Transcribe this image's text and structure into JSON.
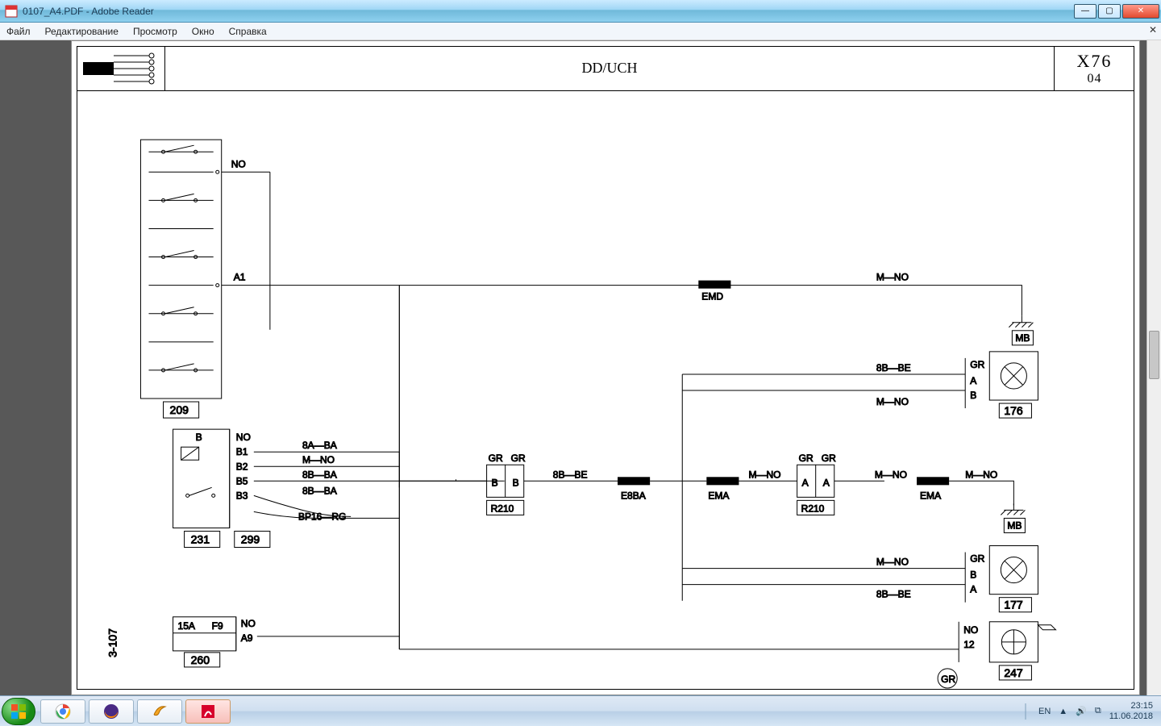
{
  "window": {
    "title": "0107_A4.PDF - Adobe Reader"
  },
  "menus": {
    "file": "Файл",
    "edit": "Редактирование",
    "view": "Просмотр",
    "window": "Окно",
    "help": "Справка"
  },
  "titleblock": {
    "mid": "DD/UCH",
    "right_top": "X76",
    "right_bottom": "04"
  },
  "diagram": {
    "page_side_label": "3-107",
    "node_labels": {
      "c209": "209",
      "c231": "231",
      "c299": "299",
      "c260": "260",
      "c176": "176",
      "c177": "177",
      "c247": "247",
      "r210_a": "R210",
      "r210_b": "R210"
    },
    "wire_texts": {
      "NO1": "NO",
      "A1": "A1",
      "B": "B",
      "NO2": "NO",
      "B1": "B1",
      "B2": "B2",
      "B5": "B5",
      "B3": "B3",
      "w_8A_BA": "8A—BA",
      "w_M_NO": "M—NO",
      "w_8B_BA": "8B—BA",
      "w_8B_BA2": "8B—BA",
      "w_BP16_RG": "BP16—RG",
      "gr_l": "GR",
      "b_l": "B",
      "gr_r": "GR",
      "b_r": "B",
      "w_8B_BE": "8B—BE",
      "E8BA": "E8BA",
      "EMA_l": "EMA",
      "EMA_r": "EMA",
      "EMD": "EMD",
      "gr_a": "GR",
      "a_l": "A",
      "gr_b": "GR",
      "a_r": "A",
      "w_M_NO2": "M—NO",
      "w_M_NO3": "M—NO",
      "w_M_NO4": "M—NO",
      "w_M_NO5": "M—NO",
      "w_M_NO6": "M—NO",
      "w_8B_BE2": "8B—BE",
      "w_8B_BE3": "8B—BE",
      "MB1": "MB",
      "MB2": "MB",
      "GR176": "GR",
      "A176": "A",
      "B176": "B",
      "GR177": "GR",
      "A177": "A",
      "B177": "B",
      "NO247": "NO",
      "p12": "12",
      "GR247": "GR",
      "f15A": "15A",
      "F9": "F9",
      "NO260": "NO",
      "A9": "A9"
    }
  },
  "tray": {
    "lang": "EN",
    "time": "23:15",
    "date": "11.06.2018"
  }
}
